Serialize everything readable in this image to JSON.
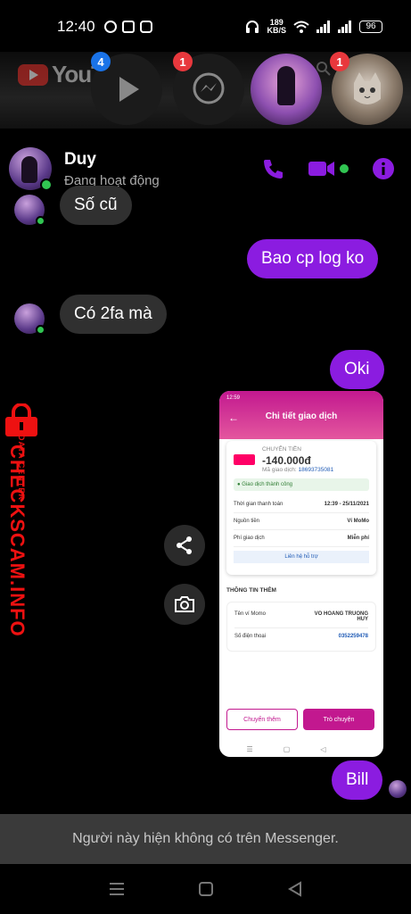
{
  "status_bar": {
    "time": "12:40",
    "net_speed_value": "189",
    "net_speed_unit": "KB/S",
    "battery": "96"
  },
  "chat_heads": {
    "bg_app_text": "YouTube",
    "video_badge": "4",
    "messenger_badge": "1",
    "kitty_badge": "1"
  },
  "header": {
    "name": "Duy",
    "status": "Đang hoạt động"
  },
  "messages": [
    {
      "dir": "in",
      "text": "Số cũ"
    },
    {
      "dir": "out",
      "text": "Bao cp log ko"
    },
    {
      "dir": "in",
      "text": "Có 2fa mà"
    },
    {
      "dir": "out",
      "text": "Oki"
    },
    {
      "dir": "out",
      "text": "Bill"
    }
  ],
  "watermark": {
    "small": "DATA CENTER",
    "big": "CHECKSCAM.INFO"
  },
  "shared_image": {
    "time": "12:59",
    "title": "Chi tiết giao dịch",
    "type": "CHUYỂN TIỀN",
    "amount": "-140.000đ",
    "code_label": "Mã giao dịch:",
    "code": "18693735081",
    "status": "Giao dịch thành công",
    "rows": [
      {
        "label": "Thời gian thanh toán",
        "value": "12:39 - 25/11/2021"
      },
      {
        "label": "Nguồn tiền",
        "value": "Ví MoMo"
      },
      {
        "label": "Phí giao dịch",
        "value": "Miễn phí"
      }
    ],
    "support": "Liên hệ hỗ trợ",
    "section": "THÔNG TIN THÊM",
    "extra": [
      {
        "label": "Tên ví Momo",
        "value": "VO HOANG TRUONG HUY"
      },
      {
        "label": "Số điện thoại",
        "value": "0352259478"
      }
    ],
    "btn_transfer": "Chuyển thêm",
    "btn_chat": "Trò chuyện"
  },
  "footer": {
    "notice": "Người này hiện không có trên Messenger."
  },
  "colors": {
    "accent": "#8b1ce0",
    "bubble_in": "#303030",
    "online": "#31c552",
    "badge_red": "#e8383d",
    "badge_blue": "#1a73e8",
    "momo": "#c2188f"
  }
}
